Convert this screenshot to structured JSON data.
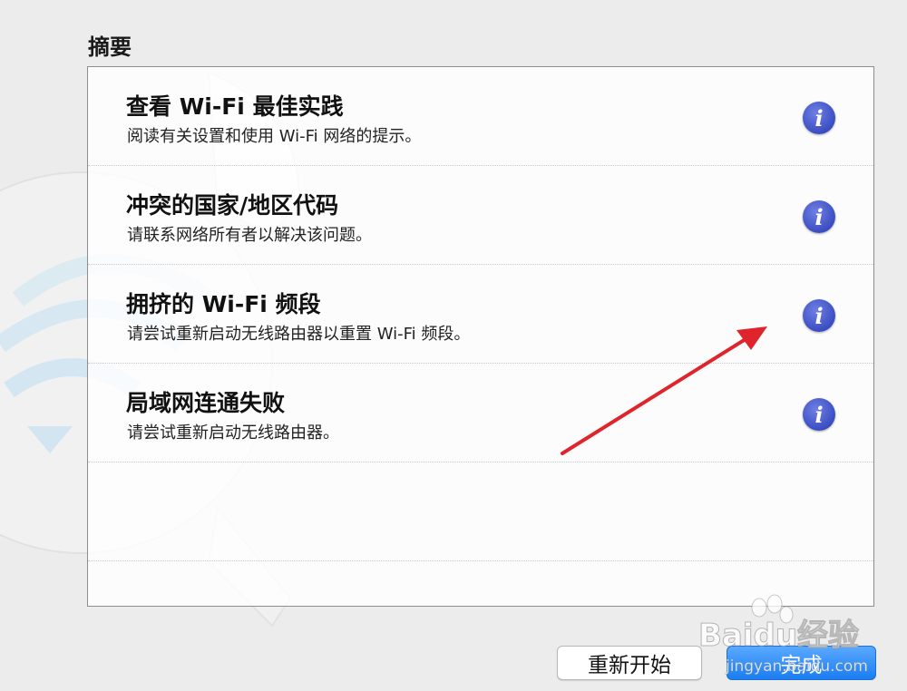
{
  "summary": {
    "title": "摘要",
    "items": [
      {
        "title": "查看 Wi-Fi 最佳实践",
        "description": "阅读有关设置和使用 Wi-Fi 网络的提示。",
        "icon": "info-icon"
      },
      {
        "title": "冲突的国家/地区代码",
        "description": "请联系网络所有者以解决该问题。",
        "icon": "info-icon"
      },
      {
        "title": "拥挤的 Wi-Fi 频段",
        "description": "请尝试重新启动无线路由器以重置 Wi-Fi 频段。",
        "icon": "info-icon"
      },
      {
        "title": "局域网连通失败",
        "description": "请尝试重新启动无线路由器。",
        "icon": "info-icon"
      }
    ]
  },
  "buttons": {
    "restart_label": "重新开始",
    "done_label": "完成"
  },
  "watermark": {
    "text": "Baidu经验",
    "url": "jingyan.baidu.com"
  },
  "colors": {
    "info_blue": "#3b4ec2",
    "primary_button": "#1a7df2",
    "annotation_arrow": "#e0242b"
  }
}
